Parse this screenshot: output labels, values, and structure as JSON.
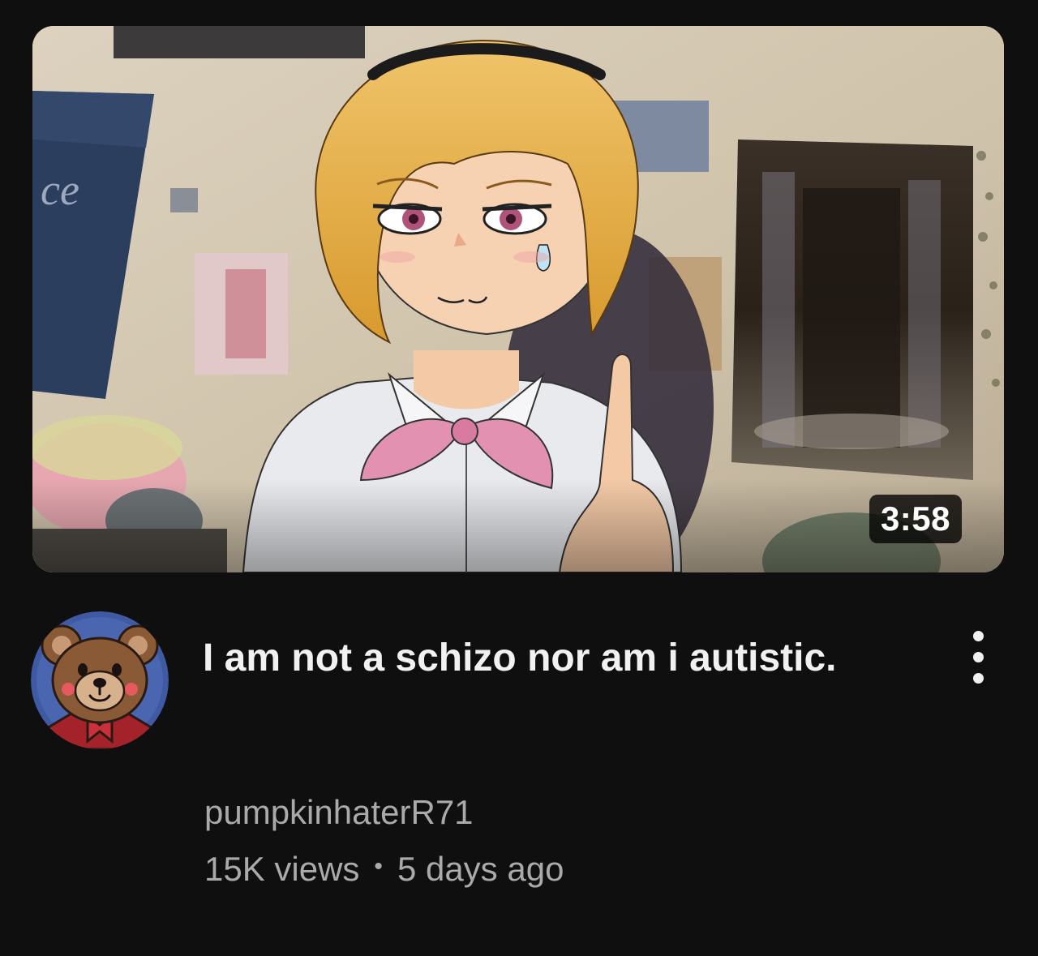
{
  "video": {
    "duration": "3:58",
    "title": "I am not a schizo nor am i autistic.",
    "channel": "pumpkinhaterR71",
    "views": "15K views",
    "separator": "•",
    "age": "5 days ago"
  },
  "icons": {
    "avatar": "teddy-bear-avatar",
    "menu": "more-vertical-icon"
  },
  "colors": {
    "background": "#0f0f0f",
    "title_text": "#f1f1f1",
    "secondary_text": "#aaaaaa"
  }
}
